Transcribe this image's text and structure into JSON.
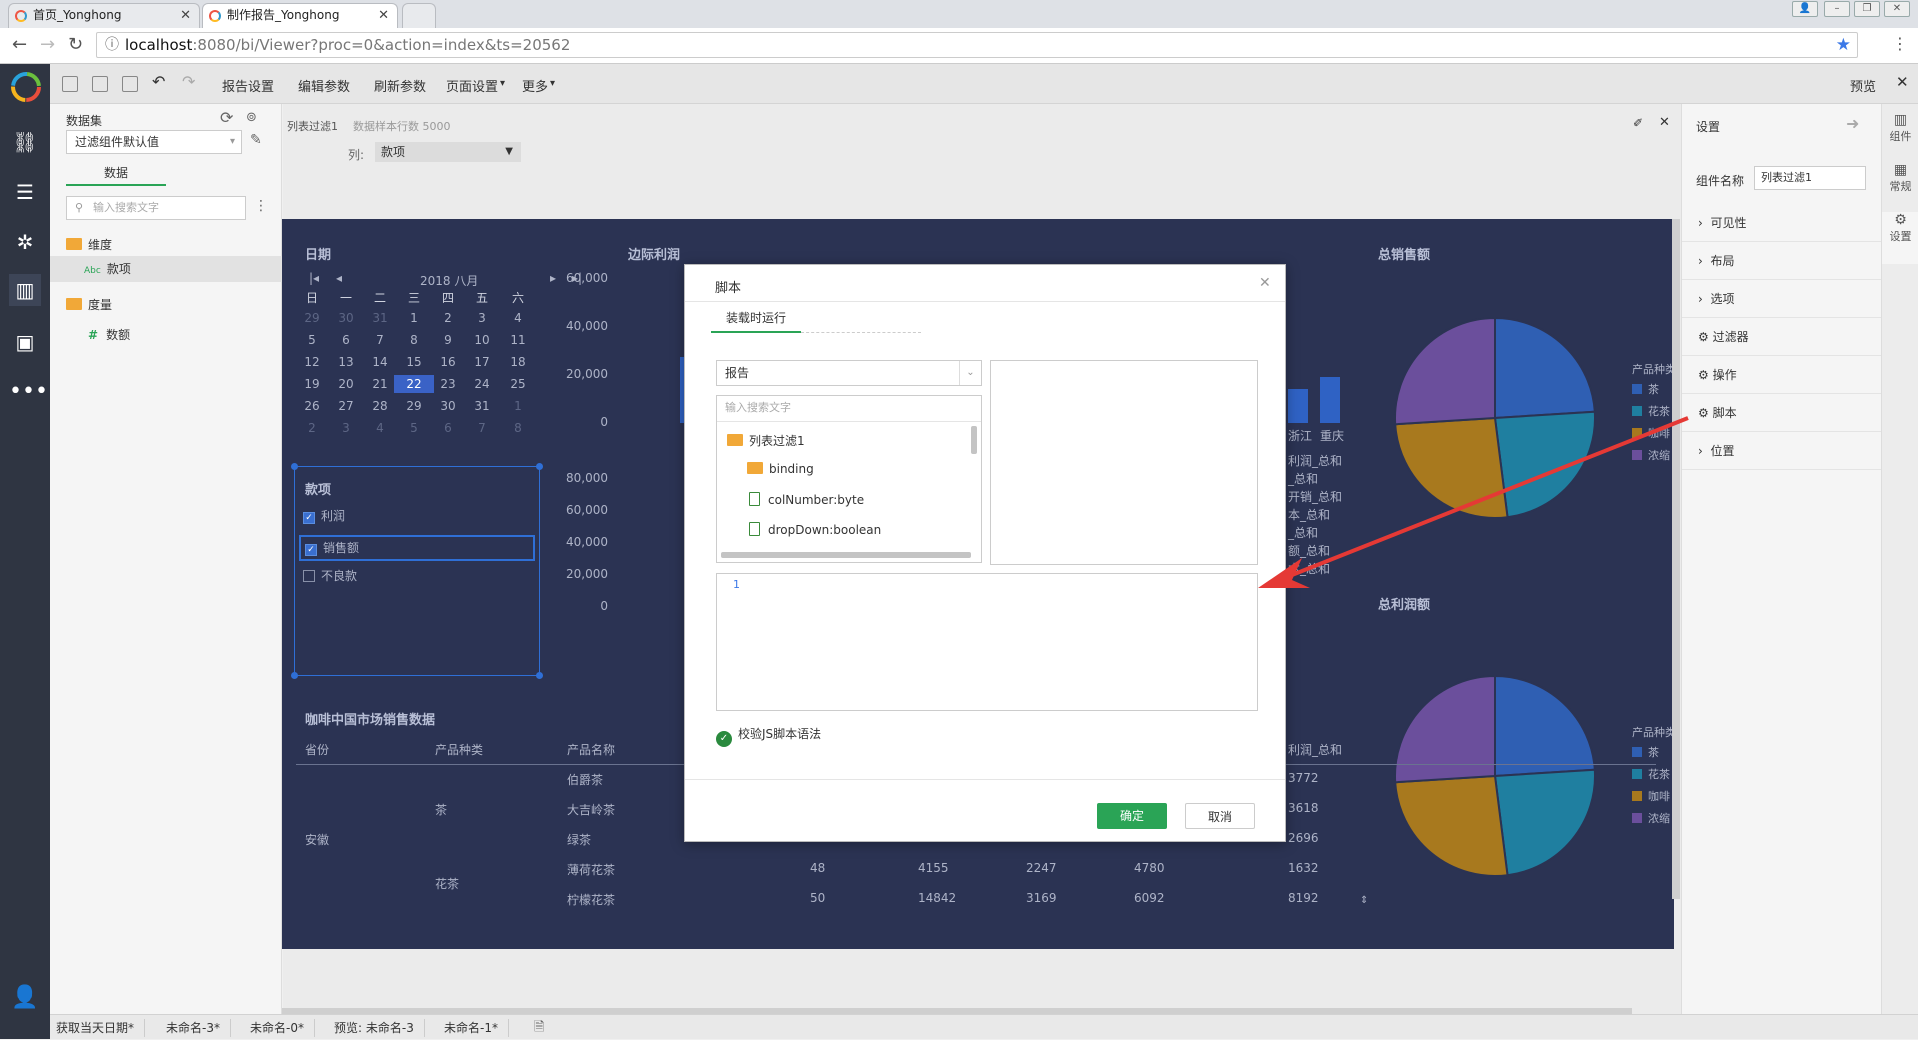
{
  "browser": {
    "tabs": [
      {
        "label": "首页_Yonghong"
      },
      {
        "label": "制作报告_Yonghong"
      }
    ],
    "url_host": "localhost",
    "url_rest": ":8080/bi/Viewer?proc=0&action=index&ts=20562"
  },
  "toolbar": {
    "items": [
      "报告设置",
      "编辑参数",
      "刷新参数",
      "页面设置",
      "更多"
    ],
    "preview": "预览"
  },
  "data_panel": {
    "title": "数据集",
    "dataset_select": "过滤组件默认值",
    "tab": "数据",
    "search_placeholder": "输入搜索文字",
    "dimension_label": "维度",
    "dimension_field": "款项",
    "measure_label": "度量",
    "measure_field": "数额",
    "abc_tag": "Abc",
    "hash_tag": "#"
  },
  "component_bar": {
    "name": "列表过滤1",
    "sample_info": "数据样本行数 5000",
    "col_label": "列:",
    "col_value": "款项"
  },
  "report": {
    "date_title": "日期",
    "month_label": "2018 八月",
    "weekdays": [
      "日",
      "一",
      "二",
      "三",
      "四",
      "五",
      "六"
    ],
    "weeks": [
      [
        "29",
        "30",
        "31",
        "1",
        "2",
        "3",
        "4"
      ],
      [
        "5",
        "6",
        "7",
        "8",
        "9",
        "10",
        "11"
      ],
      [
        "12",
        "13",
        "14",
        "15",
        "16",
        "17",
        "18"
      ],
      [
        "19",
        "20",
        "21",
        "22",
        "23",
        "24",
        "25"
      ],
      [
        "26",
        "27",
        "28",
        "29",
        "30",
        "31",
        "1"
      ],
      [
        "2",
        "3",
        "4",
        "5",
        "6",
        "7",
        "8"
      ]
    ],
    "selected_day": "22",
    "filter_title": "款项",
    "filter_items": [
      {
        "label": "利润",
        "checked": true
      },
      {
        "label": "销售额",
        "checked": true
      },
      {
        "label": "不良款",
        "checked": false
      }
    ],
    "margin_title": "边际利润",
    "margin_axis_top": [
      "60,000",
      "40,000",
      "20,000",
      "0"
    ],
    "margin_axis_bottom": [
      "80,000",
      "60,000",
      "40,000",
      "20,000",
      "0"
    ],
    "margin_region_labels": [
      "浙江",
      "重庆"
    ],
    "margin_right_labels": [
      "利润_总和",
      "_总和",
      "开销_总和",
      "本_总和",
      "_总和",
      "额_总和",
      "本_总和"
    ],
    "sales_title": "总销售额",
    "profit_title": "总利润额",
    "legend_title": "产品种类",
    "legend": [
      {
        "label": "茶",
        "color": "#2f5fb3"
      },
      {
        "label": "花茶",
        "color": "#1f7fa0"
      },
      {
        "label": "咖啡",
        "color": "#a8791e"
      },
      {
        "label": "浓缩",
        "color": "#6b4f9c"
      }
    ],
    "table_title": "咖啡中国市场销售数据",
    "table_headers": [
      "省份",
      "产品种类",
      "产品名称"
    ],
    "table_last_header": "利润_总和",
    "table_province": "安徽",
    "table_groups": [
      "茶",
      "花茶"
    ],
    "table_rows": [
      {
        "name": "伯爵茶",
        "vals": [
          "",
          "",
          "",
          "",
          "3772"
        ]
      },
      {
        "name": "大吉岭茶",
        "vals": [
          "",
          "",
          "",
          "",
          "3618"
        ]
      },
      {
        "name": "绿茶",
        "vals": [
          "",
          "",
          "",
          "",
          "2696"
        ]
      },
      {
        "name": "薄荷花茶",
        "vals": [
          "48",
          "4155",
          "2247",
          "4780",
          "1632"
        ]
      },
      {
        "name": "柠檬花茶",
        "vals": [
          "50",
          "14842",
          "3169",
          "6092",
          "8192"
        ]
      }
    ]
  },
  "settings_panel": {
    "title": "设置",
    "name_label": "组件名称",
    "name_value": "列表过滤1",
    "rows": [
      "可见性",
      "布局",
      "选项",
      "过滤器",
      "操作",
      "脚本",
      "位置"
    ]
  },
  "side_tabs": [
    "组件",
    "常规",
    "设置"
  ],
  "status_tabs": [
    "获取当天日期*",
    "未命名-3*",
    "未命名-0*",
    "预览: 未命名-3",
    "未命名-1*"
  ],
  "modal": {
    "title": "脚本",
    "tab": "装载时运行",
    "scope_select": "报告",
    "search_placeholder": "输入搜索文字",
    "tree": [
      {
        "label": "列表过滤1",
        "type": "root-folder"
      },
      {
        "label": "binding",
        "type": "folder"
      },
      {
        "label": "colNumber:byte",
        "type": "file"
      },
      {
        "label": "dropDown:boolean",
        "type": "file"
      }
    ],
    "line_number": "1",
    "validate_label": "校验JS脚本语法",
    "ok_label": "确定",
    "cancel_label": "取消",
    "accent_color": "#2aa456"
  }
}
